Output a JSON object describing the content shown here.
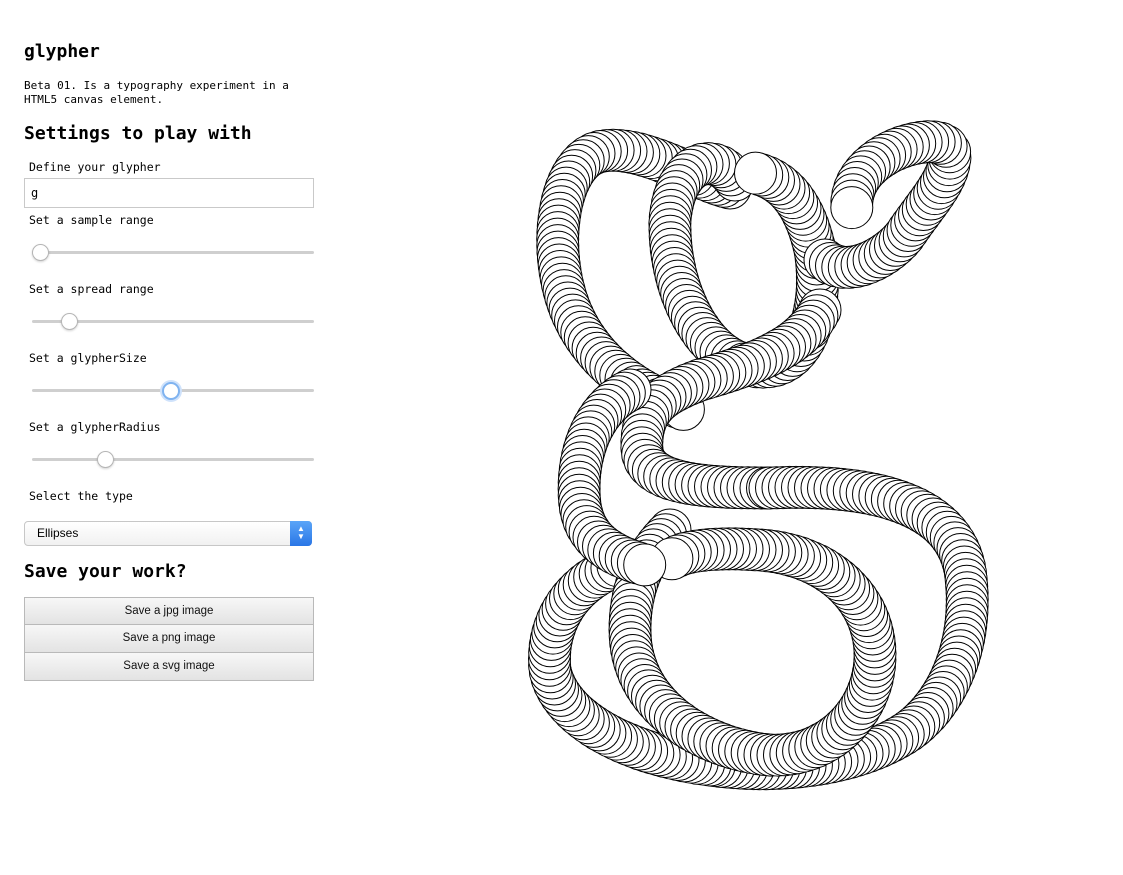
{
  "app": {
    "title": "glypher",
    "description": "Beta 01. Is a typography experiment in a HTML5 canvas element."
  },
  "settings": {
    "heading": "Settings to play with",
    "glypher_label": "Define your glypher",
    "glypher_value": "g",
    "sliders": [
      {
        "label": "Set a sample range",
        "value": 0.03
      },
      {
        "label": "Set a spread range",
        "value": 0.13
      },
      {
        "label": "Set a glypherSize",
        "value": 0.49
      },
      {
        "label": "Set a glypherRadius",
        "value": 0.26
      }
    ],
    "type_label": "Select the type",
    "type_value": "Ellipses"
  },
  "save": {
    "heading": "Save your work?",
    "jpg": "Save a jpg image",
    "png": "Save a png image",
    "svg": "Save a svg image"
  },
  "canvas": {
    "glyph": "g",
    "stroke_color": "#000000",
    "fill_color": "#ffffff"
  },
  "colors": {
    "accent": "#3b8ff0",
    "focus": "#7fb3f0"
  }
}
